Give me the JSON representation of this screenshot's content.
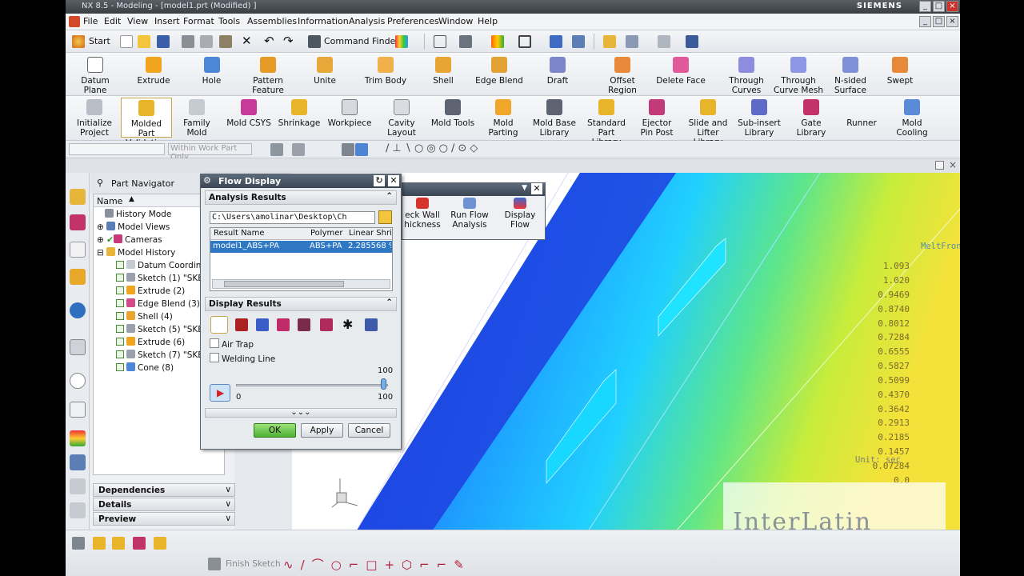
{
  "window": {
    "title": "NX 8.5 - Modeling - [model1.prt (Modified) ]",
    "brand": "SIEMENS"
  },
  "menu": [
    "File",
    "Edit",
    "View",
    "Insert",
    "Format",
    "Tools",
    "Assemblies",
    "Information",
    "Analysis",
    "Preferences",
    "Window",
    "Help"
  ],
  "toolbar": {
    "start": "Start",
    "command_finder": "Command Finder"
  },
  "ribbon1": [
    "Datum Plane",
    "Extrude",
    "Hole",
    "Pattern Feature",
    "Unite",
    "Trim Body",
    "Shell",
    "Edge Blend",
    "Draft",
    "Offset Region",
    "Delete Face",
    "Through Curves",
    "Through Curve Mesh",
    "N-sided Surface",
    "Swept"
  ],
  "ribbon2": [
    "Initialize Project",
    "Molded Part Validation",
    "Family Mold",
    "Mold CSYS",
    "Shrinkage",
    "Workpiece",
    "Cavity Layout",
    "Mold Tools",
    "Mold Parting",
    "Mold Base Library",
    "Standard Part Library",
    "Ejector Pin Post",
    "Slide and Lifter Library",
    "Sub-insert Library",
    "Gate Library",
    "Runner",
    "Mold Cooling"
  ],
  "selection_filter": "Within Work Part Only",
  "navigator": {
    "title": "Part Navigator",
    "column": "Name",
    "items": [
      "History Mode",
      "Model Views",
      "Cameras",
      "Model History",
      "Datum Coordina",
      "Sketch (1) \"SKET",
      "Extrude (2)",
      "Edge Blend (3)",
      "Shell (4)",
      "Sketch (5) \"SKET",
      "Extrude (6)",
      "Sketch (7) \"SKET",
      "Cone (8)"
    ],
    "panels": [
      "Dependencies",
      "Details",
      "Preview"
    ]
  },
  "flow_dialog": {
    "title": "Flow Display",
    "analysis_section": "Analysis Results",
    "path": "C:\\Users\\amolinar\\Desktop\\Ch",
    "columns": [
      "Result Name",
      "Polymer",
      "Linear Shri"
    ],
    "row": [
      "model1_ABS+PA",
      "ABS+PA",
      "2.285568 %"
    ],
    "display_section": "Display Results",
    "air_trap": "Air Trap",
    "welding_line": "Welding Line",
    "slider_max_label": "100",
    "slider_min": "0",
    "slider_max": "100",
    "ok": "OK",
    "apply": "Apply",
    "cancel": "Cancel"
  },
  "palette": {
    "items": [
      "eck Wall\nhickness",
      "Run Flow\nAnalysis",
      "Display\nFlow"
    ]
  },
  "legend": {
    "title": "MeltFrontTime",
    "values": [
      "1.093",
      "1.020",
      "0.9469",
      "0.8740",
      "0.8012",
      "0.7284",
      "0.6555",
      "0.5827",
      "0.5099",
      "0.4370",
      "0.3642",
      "0.2913",
      "0.2185",
      "0.1457",
      "0.07284",
      "0.0"
    ],
    "unit": "Unit: sec"
  },
  "watermark": "InterLatin",
  "bottombar": {
    "finish_sketch": "Finish Sketch"
  },
  "colors": {
    "accent": "#2f78c4",
    "ok_green": "#4fb134"
  }
}
